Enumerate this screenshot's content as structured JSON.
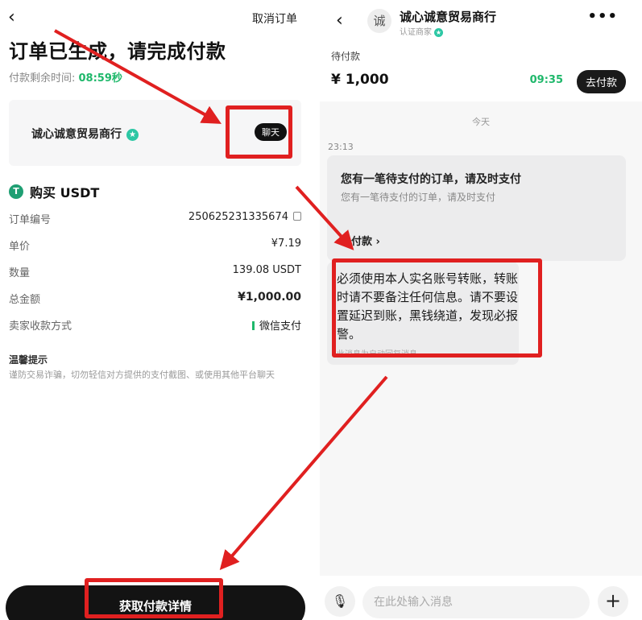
{
  "left": {
    "back_icon": "chevron-left-icon",
    "cancel_order": "取消订单",
    "title": "订单已生成，请完成付款",
    "timer_label": "付款剩余时间: ",
    "timer_value": "08:59秒",
    "merchant_name": "诚心诚意贸易商行",
    "chat_button": "聊天",
    "buy_title": "购买 USDT",
    "details": [
      {
        "label": "订单编号",
        "value": "250625231335674"
      },
      {
        "label": "单价",
        "value": "¥7.19"
      },
      {
        "label": "数量",
        "value": "139.08 USDT"
      },
      {
        "label": "总金额",
        "value": "¥1,000.00"
      },
      {
        "label": "卖家收款方式",
        "value": "微信支付"
      }
    ],
    "tips_title": "温馨提示",
    "tips_text": "谨防交易诈骗，切勿轻信对方提供的支付截图、或使用其他平台聊天",
    "pay_details_button": "获取付款详情"
  },
  "right": {
    "avatar_text": "诚",
    "merchant_name": "诚心诚意贸易商行",
    "verified_label": "认证商家",
    "pending_label": "待付款",
    "amount": "¥ 1,000",
    "countdown": "09:35",
    "go_pay_button": "去付款",
    "date_divider": "今天",
    "message_time": "23:13",
    "notice_title": "您有一笔待支付的订单，请及时支付",
    "notice_sub": "您有一笔待支付的订单，请及时支付",
    "notice_action": "去付款 ›",
    "auto_reply_text": "必须使用本人实名账号转账，转账时请不要备注任何信息。请不要设置延迟到账，黑钱绕道，发现必报警。",
    "auto_reply_note": "此消息为自动回复消息",
    "input_placeholder": "在此处输入消息"
  },
  "colors": {
    "accent_green": "#1fb86b",
    "annotation_red": "#e02020",
    "button_dark": "#131313"
  }
}
